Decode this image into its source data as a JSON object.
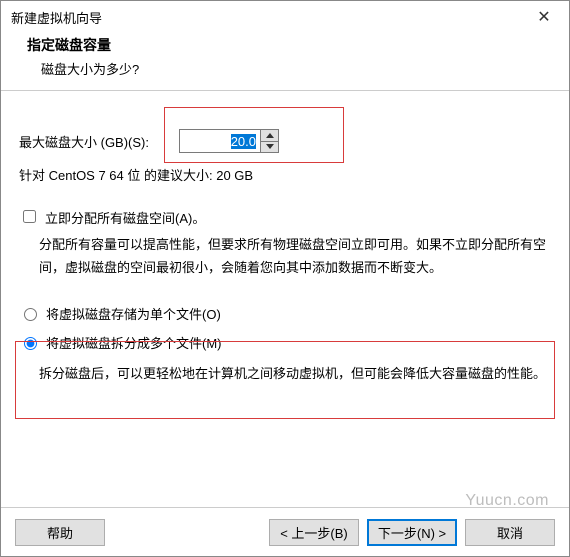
{
  "window": {
    "title": "新建虚拟机向导",
    "close_tooltip": "关闭"
  },
  "header": {
    "title": "指定磁盘容量",
    "subtitle": "磁盘大小为多少?"
  },
  "disk_size": {
    "label": "最大磁盘大小 (GB)(S):",
    "value": "20.0"
  },
  "suggestion": "针对 CentOS 7 64 位 的建议大小: 20 GB",
  "allocate": {
    "label": "立即分配所有磁盘空间(A)。",
    "checked": false,
    "desc": "分配所有容量可以提高性能，但要求所有物理磁盘空间立即可用。如果不立即分配所有空间，虚拟磁盘的空间最初很小，会随着您向其中添加数据而不断变大。"
  },
  "store_options": {
    "single": {
      "label": "将虚拟磁盘存储为单个文件(O)",
      "selected": false
    },
    "split": {
      "label": "将虚拟磁盘拆分成多个文件(M)",
      "selected": true
    },
    "split_desc": "拆分磁盘后，可以更轻松地在计算机之间移动虚拟机，但可能会降低大容量磁盘的性能。"
  },
  "buttons": {
    "help": "帮助",
    "back": "< 上一步(B)",
    "next": "下一步(N) >",
    "cancel": "取消"
  },
  "watermark": "Yuucn.com"
}
